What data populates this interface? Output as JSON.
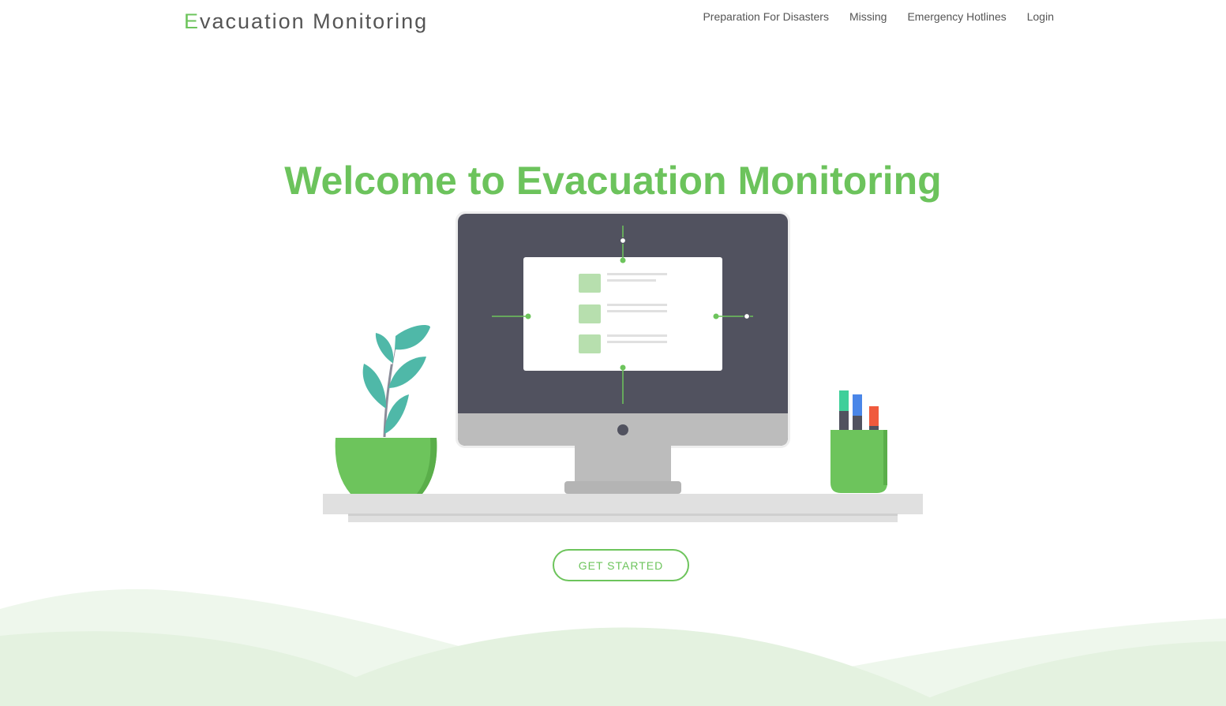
{
  "navbar": {
    "brand_first": "E",
    "brand_rest": "vacuation Monitoring",
    "links": [
      {
        "label": "Preparation For Disasters"
      },
      {
        "label": "Missing"
      },
      {
        "label": "Emergency Hotlines"
      },
      {
        "label": "Login"
      }
    ]
  },
  "hero": {
    "title": "Welcome to Evacuation Monitoring",
    "cta_label": "GET STARTED"
  },
  "colors": {
    "accent": "#6dc45c",
    "monitor_screen": "#51525f",
    "text": "#555555",
    "hill_light": "#eef7ec",
    "hill_mid": "#e3f2df"
  }
}
